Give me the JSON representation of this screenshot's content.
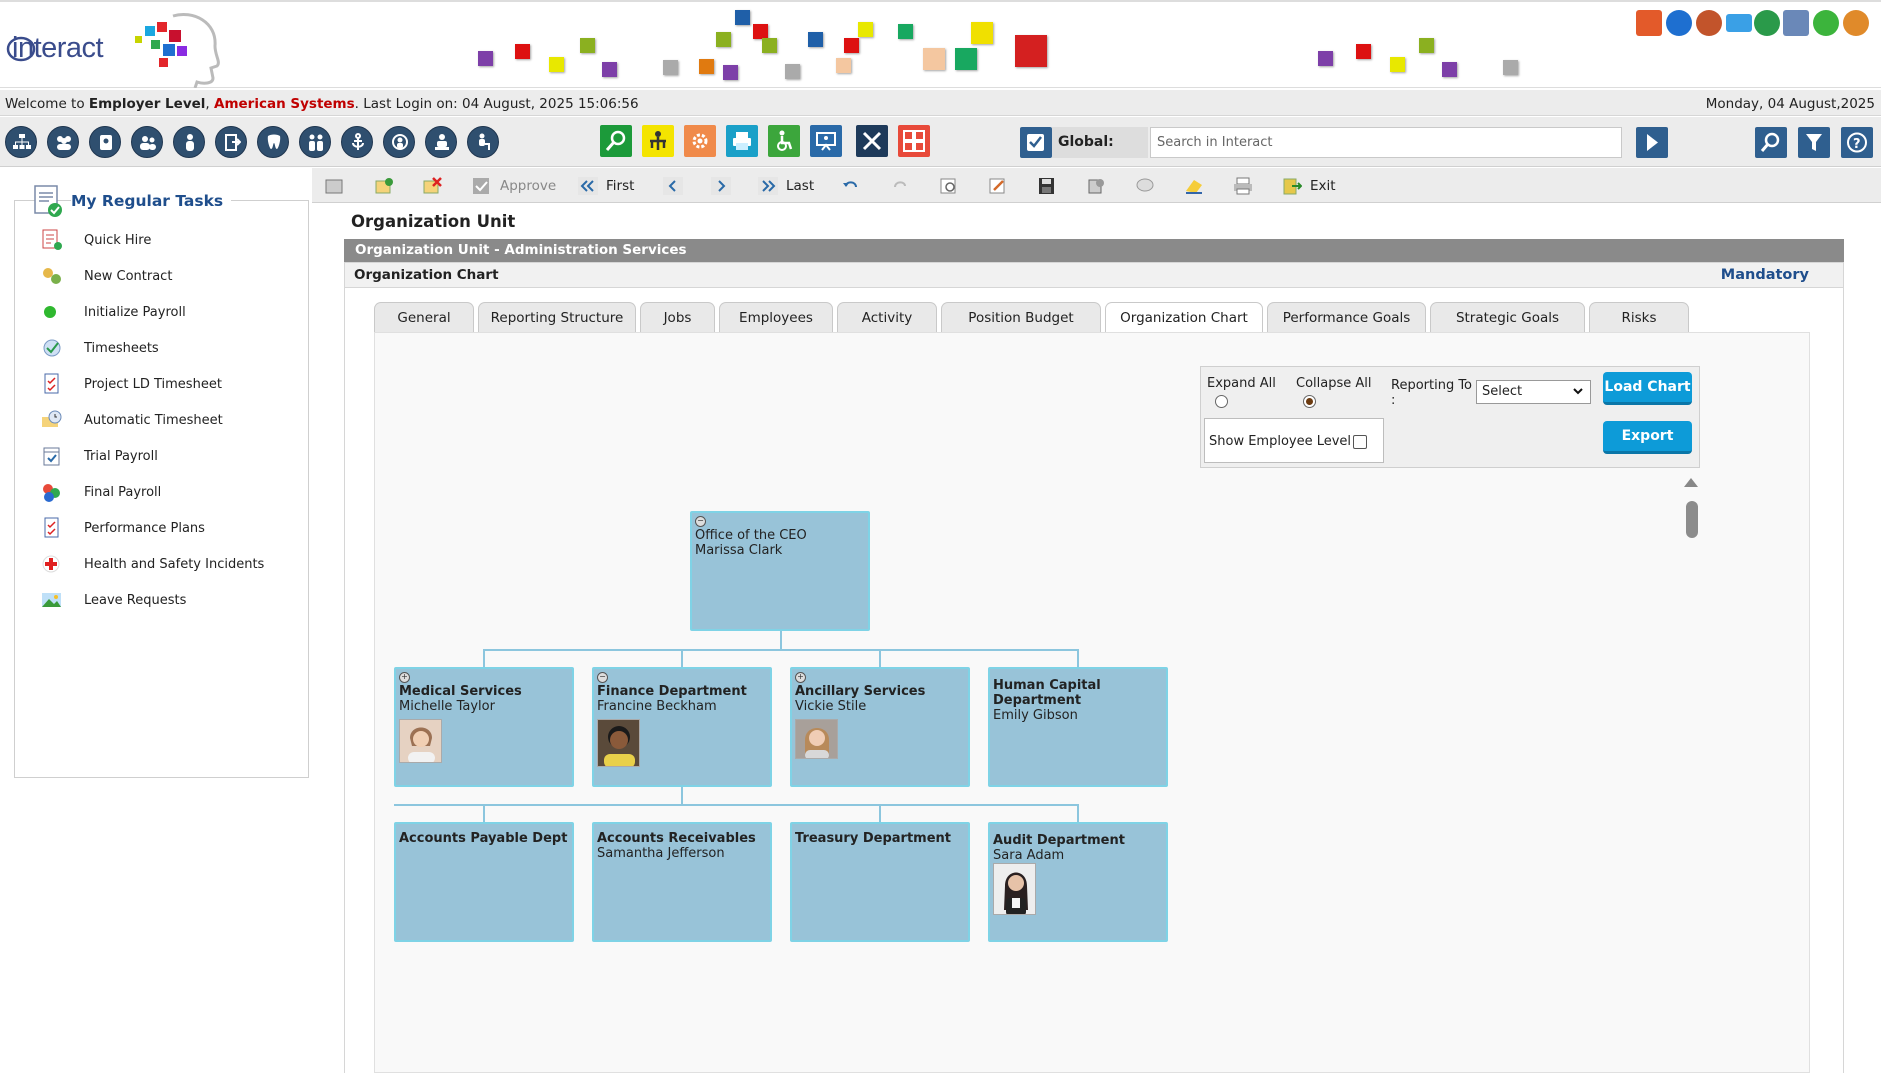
{
  "app": {
    "logo_text": "interact"
  },
  "welcome": {
    "prefix": "Welcome to ",
    "level": "Employer Level",
    "sep": ", ",
    "company": "American Systems",
    "last_login": ". Last Login on: 04 August, 2025 15:06:56",
    "date": "Monday, 04 August,2025"
  },
  "global_search": {
    "label": "Global:",
    "placeholder": "Search in Interact"
  },
  "tasks": {
    "title": "My Regular Tasks",
    "items": [
      {
        "label": "Quick Hire",
        "icon": "quick-hire-icon"
      },
      {
        "label": "New Contract",
        "icon": "new-contract-icon"
      },
      {
        "label": "Initialize Payroll",
        "icon": "green-dot-icon"
      },
      {
        "label": "Timesheets",
        "icon": "timesheets-icon"
      },
      {
        "label": "Project LD Timesheet",
        "icon": "checklist-icon"
      },
      {
        "label": "Automatic Timesheet",
        "icon": "clock-icon"
      },
      {
        "label": "Trial Payroll",
        "icon": "calendar-icon"
      },
      {
        "label": "Final Payroll",
        "icon": "final-payroll-icon"
      },
      {
        "label": "Performance Plans",
        "icon": "checklist-icon"
      },
      {
        "label": "Health and Safety Incidents",
        "icon": "red-cross-icon"
      },
      {
        "label": "Leave Requests",
        "icon": "landscape-icon"
      }
    ]
  },
  "actions": {
    "approve": "Approve",
    "first": "First",
    "last": "Last",
    "exit": "Exit"
  },
  "page": {
    "title": "Organization Unit",
    "section": "Organization Unit - Administration Services",
    "subsection": "Organization Chart",
    "mandatory": "Mandatory"
  },
  "tabs": [
    {
      "label": "General"
    },
    {
      "label": "Reporting Structure"
    },
    {
      "label": "Jobs"
    },
    {
      "label": "Employees"
    },
    {
      "label": "Activity"
    },
    {
      "label": "Position Budget"
    },
    {
      "label": "Organization Chart",
      "active": true
    },
    {
      "label": "Performance Goals"
    },
    {
      "label": "Strategic Goals"
    },
    {
      "label": "Risks"
    }
  ],
  "chart_controls": {
    "expand_all": "Expand All",
    "collapse_all": "Collapse All",
    "selected_mode": "Collapse All",
    "reporting_to": "Reporting To",
    "reporting_to_colon": ":",
    "reporting_to_value": "Select",
    "show_employee_level": "Show Employee Level",
    "show_employee_level_checked": false,
    "load_chart": "Load Chart",
    "export": "Export"
  },
  "org_chart": {
    "root": {
      "title": "Office of the CEO",
      "person": "Marissa Clark",
      "toggle": "−"
    },
    "level1": [
      {
        "title": "Medical Services",
        "person": "Michelle Taylor",
        "toggle": "+",
        "photo": true
      },
      {
        "title": "Finance Department",
        "person": "Francine Beckham",
        "toggle": "−",
        "photo": true
      },
      {
        "title": "Ancillary Services",
        "person": "Vickie Stile",
        "toggle": "+",
        "photo": true
      },
      {
        "title": "Human Capital Department",
        "person": "Emily Gibson",
        "toggle": "",
        "photo": false
      }
    ],
    "level2": [
      {
        "title": "Accounts Payable Dept",
        "person": "",
        "photo": false
      },
      {
        "title": "Accounts Receivables",
        "person": "Samantha Jefferson",
        "photo": false
      },
      {
        "title": "Treasury Department",
        "person": "",
        "photo": false
      },
      {
        "title": "Audit Department",
        "person": "Sara Adam",
        "photo": true
      }
    ]
  },
  "colors": {
    "node_fill": "#98c3d8",
    "node_border": "#7fd3e6",
    "accent_button": "#0d9bd8",
    "company_red": "#c00000",
    "title_blue": "#1f4e8c"
  }
}
